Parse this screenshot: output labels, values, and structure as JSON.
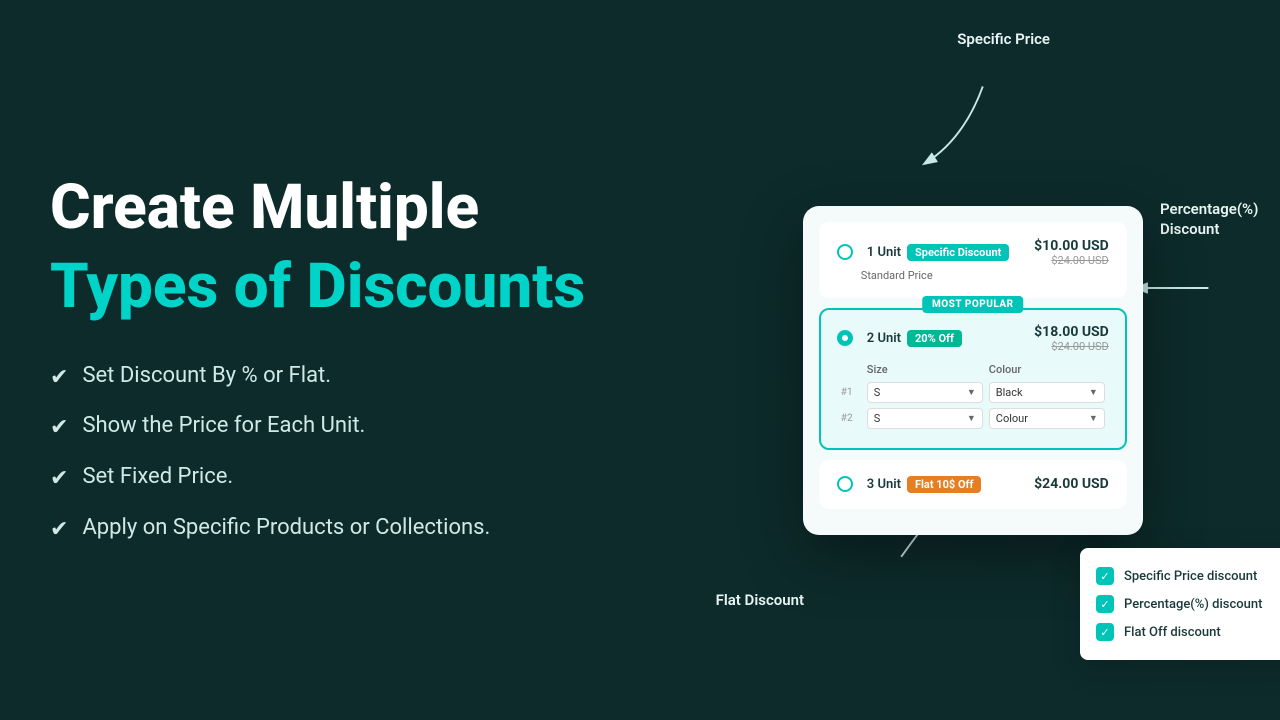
{
  "left": {
    "title_line1": "Create Multiple",
    "title_line2": "Types of Discounts",
    "features": [
      "Set Discount By % or Flat.",
      "Show the Price for Each Unit.",
      "Set Fixed Price.",
      "Apply on Specific Products or Collections."
    ]
  },
  "right": {
    "annotation_specific_price": "Specific Price",
    "annotation_percentage": "Percentage(%)\nDiscount",
    "annotation_flat": "Flat Discount",
    "tiers": [
      {
        "number": "1",
        "unit_label": "Unit",
        "badge_text": "Specific Discount",
        "badge_color": "teal",
        "price_main": "$10.00 USD",
        "price_old": "$24.00 USD",
        "sub_label": "Standard Price",
        "active": false
      },
      {
        "number": "2",
        "unit_label": "Unit",
        "badge_text": "20% Off",
        "badge_color": "green",
        "price_main": "$18.00 USD",
        "price_old": "$24.00 USD",
        "most_popular": "MOST POPULAR",
        "active": true,
        "variants": [
          {
            "num": "#1",
            "size": "S",
            "colour": "Black"
          },
          {
            "num": "#2",
            "size": "S",
            "colour": "Colour"
          }
        ]
      },
      {
        "number": "3",
        "unit_label": "Unit",
        "badge_text": "Flat 10$ Off",
        "badge_color": "orange",
        "price_main": "$24.00 USD",
        "active": false
      }
    ],
    "tooltip": {
      "items": [
        "Specific Price discount",
        "Percentage(%) discount",
        "Flat Off discount"
      ]
    },
    "variant_headers": {
      "size": "Size",
      "colour": "Colour"
    }
  }
}
